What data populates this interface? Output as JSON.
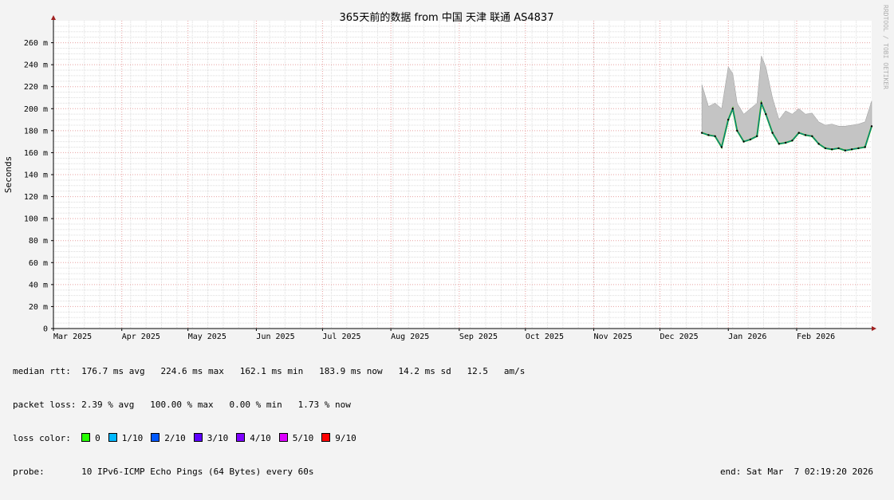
{
  "chart_data": {
    "type": "area",
    "title": "365天前的数据 from 中国 天津 联通 AS4837",
    "ylabel": "Seconds",
    "xlabel": "",
    "y_unit_suffix": "m",
    "ylim": [
      0,
      280
    ],
    "y_ticks": [
      0,
      20,
      40,
      60,
      80,
      100,
      120,
      140,
      160,
      180,
      200,
      220,
      240,
      260
    ],
    "x_range": [
      "2025-03-01",
      "2026-03-07"
    ],
    "x_ticks": [
      {
        "label": "Mar 2025",
        "date": "2025-03-01"
      },
      {
        "label": "Apr 2025",
        "date": "2025-04-01"
      },
      {
        "label": "May 2025",
        "date": "2025-05-01"
      },
      {
        "label": "Jun 2025",
        "date": "2025-06-01"
      },
      {
        "label": "Jul 2025",
        "date": "2025-07-01"
      },
      {
        "label": "Aug 2025",
        "date": "2025-08-01"
      },
      {
        "label": "Sep 2025",
        "date": "2025-09-01"
      },
      {
        "label": "Oct 2025",
        "date": "2025-10-01"
      },
      {
        "label": "Nov 2025",
        "date": "2025-11-01"
      },
      {
        "label": "Dec 2025",
        "date": "2025-12-01"
      },
      {
        "label": "Jan 2026",
        "date": "2026-01-01"
      },
      {
        "label": "Feb 2026",
        "date": "2026-02-01"
      }
    ],
    "grid": true,
    "series": [
      {
        "x": [
          "2025-12-20",
          "2025-12-23",
          "2025-12-26",
          "2025-12-29",
          "2026-01-01",
          "2026-01-03",
          "2026-01-05",
          "2026-01-08",
          "2026-01-11",
          "2026-01-14",
          "2026-01-16",
          "2026-01-18",
          "2026-01-21",
          "2026-01-24",
          "2026-01-27",
          "2026-01-30",
          "2026-02-02",
          "2026-02-05",
          "2026-02-08",
          "2026-02-11",
          "2026-02-14",
          "2026-02-17",
          "2026-02-20",
          "2026-02-23",
          "2026-02-26",
          "2026-03-01",
          "2026-03-04",
          "2026-03-07"
        ],
        "values": [
          178,
          176,
          175,
          165,
          190,
          200,
          180,
          170,
          172,
          175,
          205,
          195,
          178,
          168,
          169,
          171,
          178,
          176,
          175,
          168,
          164,
          163,
          164,
          162,
          163,
          164,
          165,
          184
        ],
        "max_values": [
          222,
          202,
          205,
          200,
          238,
          232,
          205,
          195,
          200,
          205,
          248,
          238,
          210,
          190,
          198,
          195,
          200,
          195,
          196,
          188,
          185,
          186,
          184,
          184,
          185,
          186,
          188,
          207
        ]
      }
    ]
  },
  "watermark": "RRDTOOL / TOBI OETIKER",
  "stats": {
    "median_label": "median rtt:",
    "median_values": "176.7 ms avg   224.6 ms max   162.1 ms min   183.9 ms now   14.2 ms sd   12.5   am/s",
    "loss_label": "packet loss:",
    "loss_values": "2.39 % avg   100.00 % max   0.00 % min   1.73 % now",
    "color_label": "loss color:",
    "loss_colors": [
      {
        "label": "0",
        "color": "#26ff00"
      },
      {
        "label": "1/10",
        "color": "#00b8ff"
      },
      {
        "label": "2/10",
        "color": "#0059ff"
      },
      {
        "label": "3/10",
        "color": "#5e00ff"
      },
      {
        "label": "4/10",
        "color": "#7e00ff"
      },
      {
        "label": "5/10",
        "color": "#dd00ff"
      },
      {
        "label": "9/10",
        "color": "#ff0000"
      }
    ],
    "probe_label": "probe:",
    "probe_value": "10 IPv6-ICMP Echo Pings (64 Bytes) every 60s",
    "end_label": "end: Sat Mar  7 02:19:20 2026"
  }
}
